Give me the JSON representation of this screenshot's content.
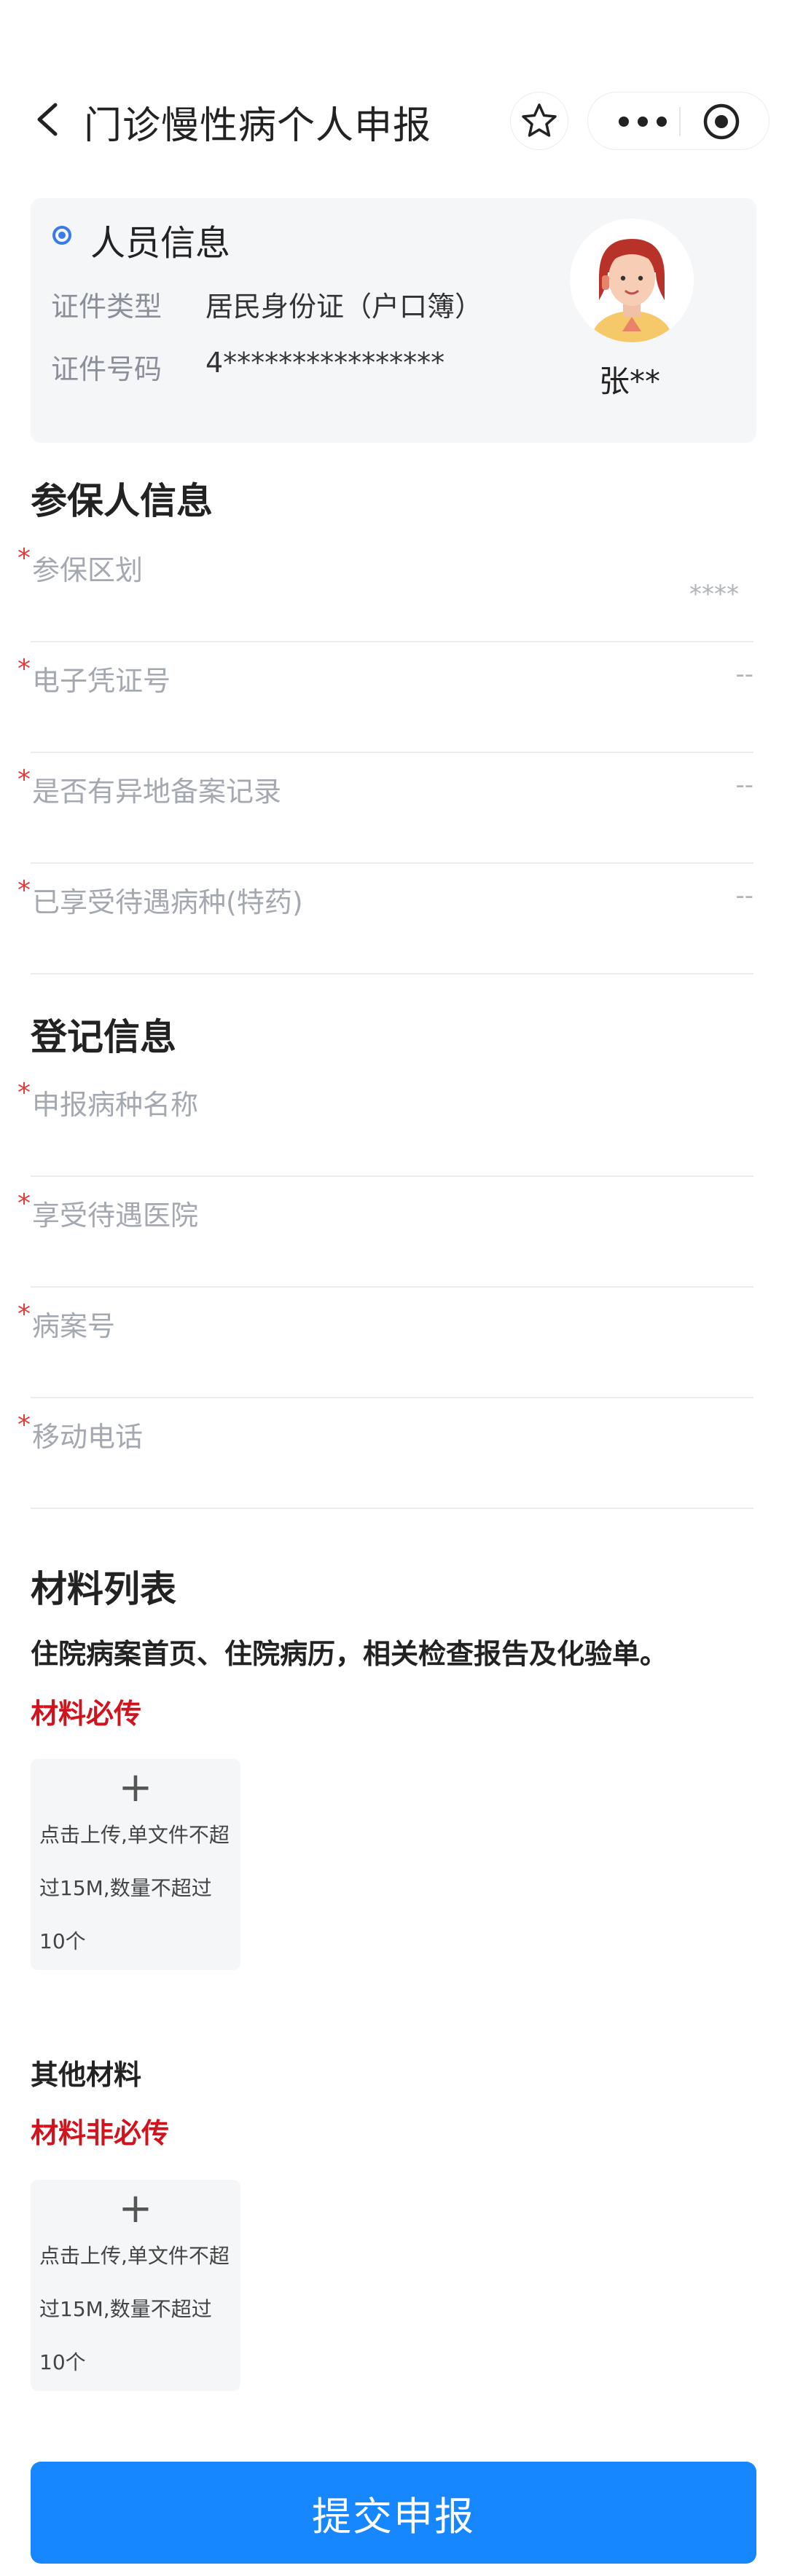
{
  "nav": {
    "title": "门诊慢性病个人申报"
  },
  "person": {
    "heading": "人员信息",
    "id_type_label": "证件类型",
    "id_type_value": "居民身份证（户口簿）",
    "id_no_label": "证件号码",
    "id_no_value": "4****************",
    "name": "张**"
  },
  "insured": {
    "title": "参保人信息",
    "rows": [
      {
        "label": "参保区划",
        "value": "****"
      },
      {
        "label": "电子凭证号",
        "value": "--"
      },
      {
        "label": "是否有异地备案记录",
        "value": "--"
      },
      {
        "label": "已享受待遇病种(特药)",
        "value": "--"
      }
    ]
  },
  "register": {
    "title": "登记信息",
    "rows": [
      {
        "label": "申报病种名称"
      },
      {
        "label": "享受待遇医院"
      },
      {
        "label": "病案号"
      },
      {
        "label": "移动电话"
      }
    ]
  },
  "materials": {
    "title": "材料列表",
    "required_desc": "住院病案首页、住院病历，相关检查报告及化验单。",
    "required_tag": "材料必传",
    "upload_plus": "+",
    "upload_tip": "点击上传,单文件不超过15M,数量不超过10个",
    "other_title": "其他材料",
    "optional_tag": "材料非必传"
  },
  "required_mark": "*",
  "submit_label": "提交申报",
  "colors": {
    "accent": "#1687ff",
    "required": "#e03c3c",
    "must_tag": "#d0141e",
    "dot": "#3a7bea"
  }
}
